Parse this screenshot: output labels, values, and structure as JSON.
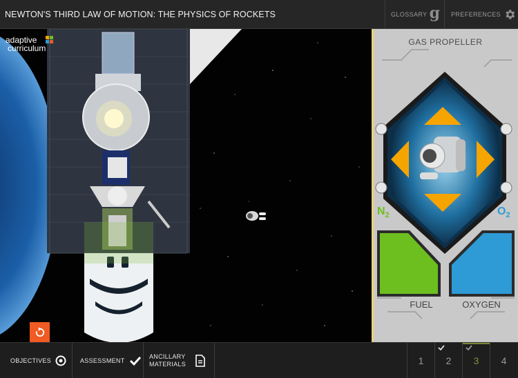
{
  "header": {
    "title": "NEWTON'S THIRD LAW OF MOTION: THE PHYSICS OF ROCKETS",
    "glossary_label": "GLOSSARY",
    "glossary_glyph": "g",
    "preferences_label": "PREFERENCES"
  },
  "logo": {
    "line1": "adaptive",
    "line2": "curriculum"
  },
  "panel": {
    "title": "GAS PROPELLER",
    "n2_label": "N",
    "n2_sub": "2",
    "o2_label": "O",
    "o2_sub": "2",
    "fuel_label": "FUEL",
    "oxygen_label": "OXYGEN",
    "fuel_level": 1.0,
    "oxygen_level": 1.0
  },
  "colors": {
    "accent_orange": "#f05a23",
    "arrow_orange": "#f6a400",
    "fuel_green": "#6cbf1e",
    "oxygen_blue": "#2e9bd6",
    "page_done": "#7c8a35"
  },
  "footer": {
    "objectives_label": "OBJECTIVES",
    "assessment_label": "ASSESSMENT",
    "ancillary_line1": "ANCILLARY",
    "ancillary_line2": "MATERIALS",
    "pages": [
      "1",
      "2",
      "3",
      "4"
    ]
  },
  "icons": {
    "glossary": "glossary-g-icon",
    "preferences": "gear-icon",
    "objectives": "target-icon",
    "assessment": "checkmark-icon",
    "ancillary": "document-icon",
    "reset": "reset-icon"
  }
}
